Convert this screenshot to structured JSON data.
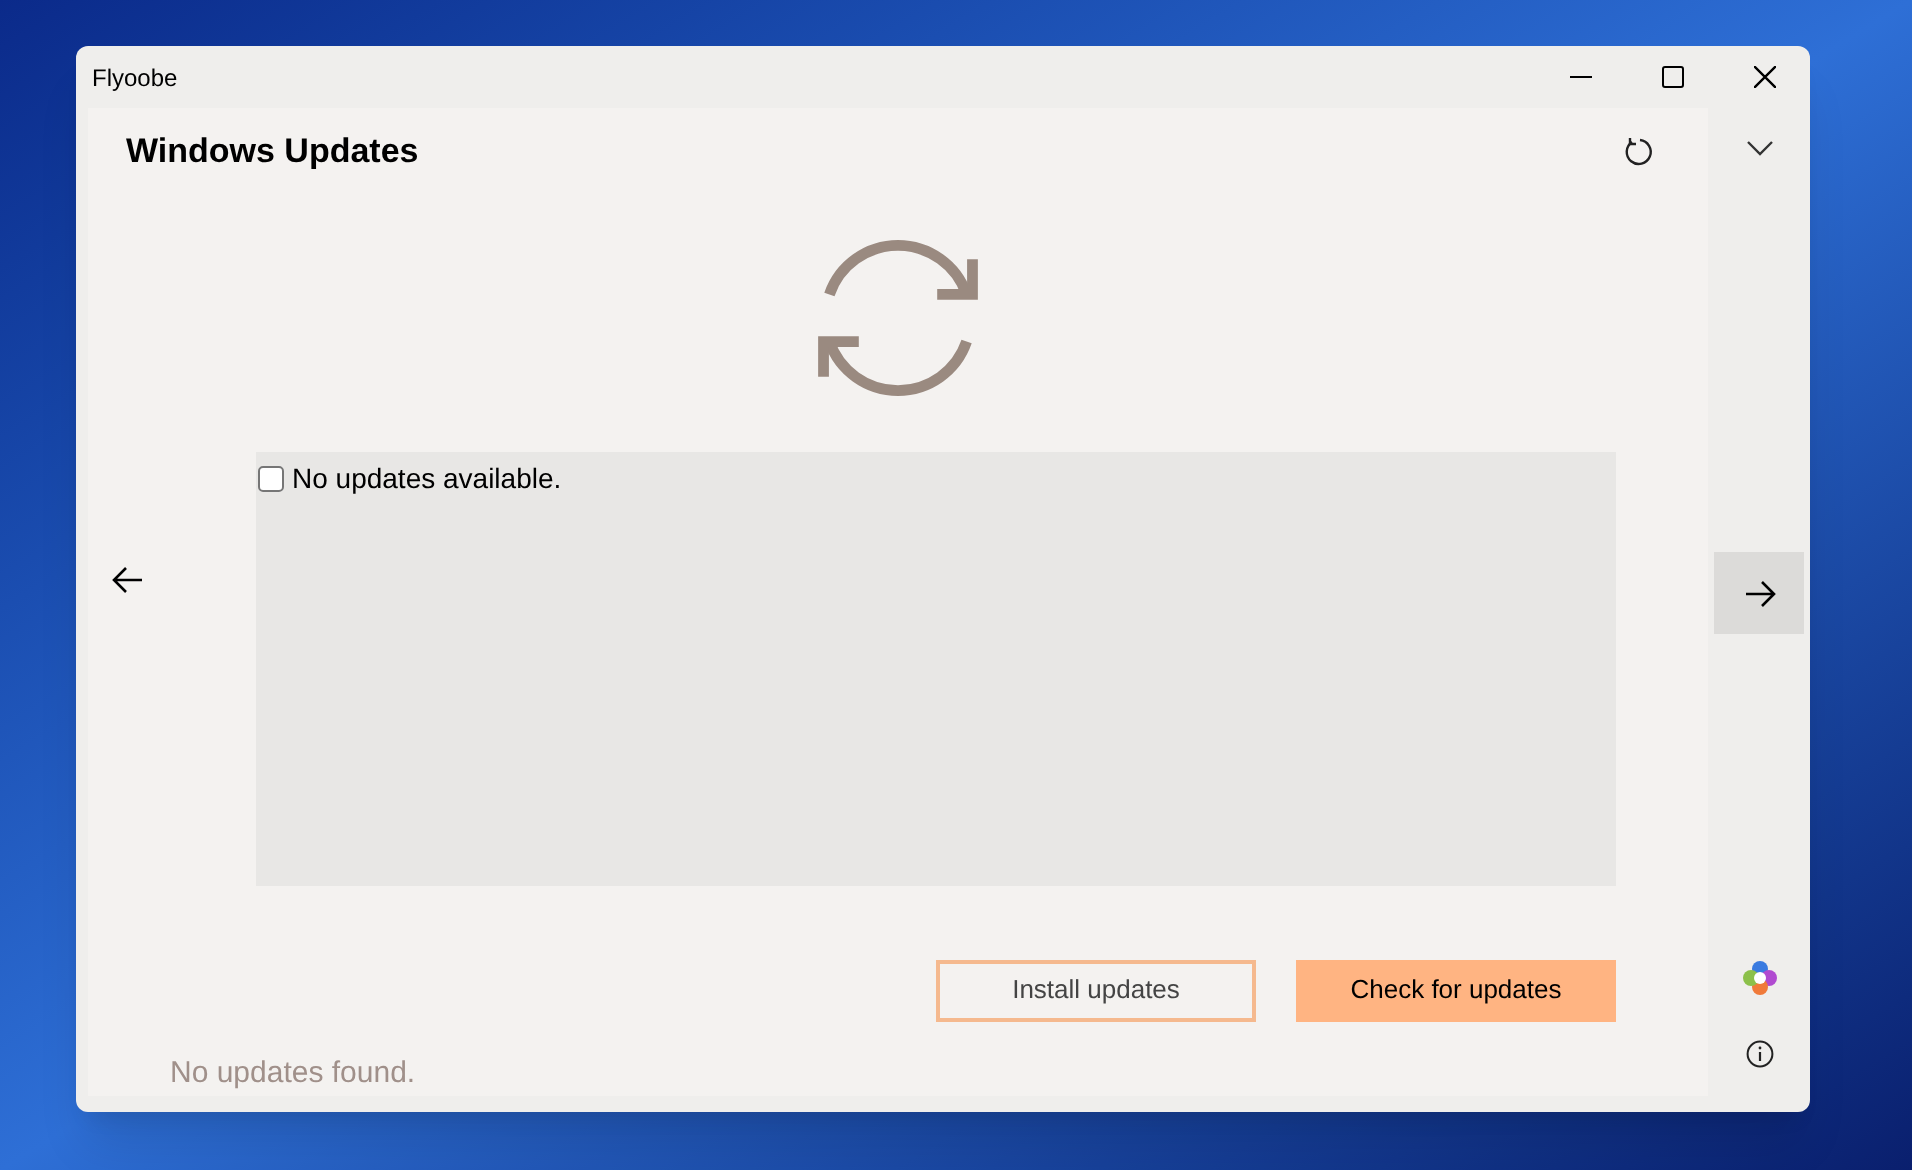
{
  "window": {
    "title": "Flyoobe"
  },
  "page": {
    "title": "Windows Updates"
  },
  "updates_list": {
    "items": [
      {
        "label": "No updates available.",
        "checked": false
      }
    ]
  },
  "buttons": [
    {
      "label": "Install updates",
      "kind": "secondary"
    },
    {
      "label": "Check for updates",
      "kind": "primary"
    }
  ],
  "status_text": "No updates found."
}
